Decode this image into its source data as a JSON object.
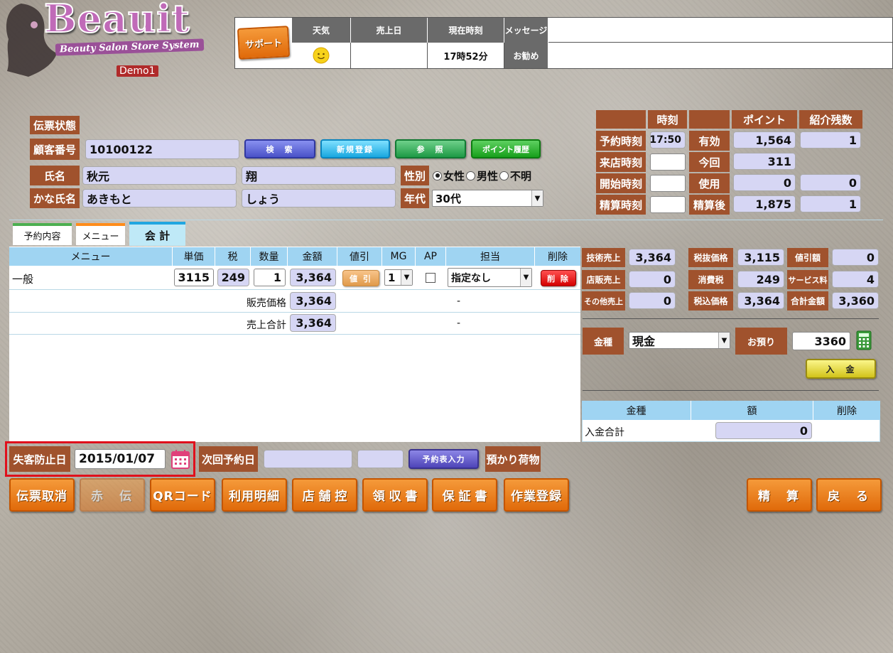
{
  "app": {
    "logo": "Beauit",
    "subtitle": "Beauty Salon Store System",
    "demo": "Demo1"
  },
  "top": {
    "support": "サポート",
    "headers": [
      "天気",
      "売上日",
      "現在時刻",
      "メッセージ"
    ],
    "weather_icon": "sun-icon",
    "sales_date": "",
    "time": "17時52分",
    "recommend": "お勧め",
    "message": ""
  },
  "customer": {
    "slip_status_label": "伝票状態",
    "number_label": "顧客番号",
    "number": "10100122",
    "search": "検　索",
    "new_register": "新規登録",
    "reference": "参　照",
    "point_history": "ポイント履歴",
    "name_label": "氏名",
    "last_name": "秋元",
    "first_name": "翔",
    "gender_label": "性別",
    "gender_options": [
      "女性",
      "男性",
      "不明"
    ],
    "gender_selected": "女性",
    "kana_label": "かな氏名",
    "kana_last": "あきもと",
    "kana_first": "しょう",
    "age_label": "年代",
    "age": "30代"
  },
  "times": {
    "time_header": "時刻",
    "point_header": "ポイント",
    "referral_header": "紹介残数",
    "rows": [
      {
        "label": "予約時刻",
        "time": "17:50",
        "plabel": "有効",
        "point": "1,564",
        "ref": "1"
      },
      {
        "label": "来店時刻",
        "time": "",
        "plabel": "今回",
        "point": "311",
        "ref": null
      },
      {
        "label": "開始時刻",
        "time": "",
        "plabel": "使用",
        "point": "0",
        "ref": "0"
      },
      {
        "label": "精算時刻",
        "time": "",
        "plabel": "精算後",
        "point": "1,875",
        "ref": "1"
      }
    ]
  },
  "tabs": [
    "予約内容",
    "メニュー",
    "会 計"
  ],
  "menu_table": {
    "headers": [
      "メニュー",
      "単価",
      "税",
      "数量",
      "金額",
      "値引",
      "MG",
      "AP",
      "担当",
      "削除"
    ],
    "row": {
      "menu": "一般",
      "price": "3115",
      "tax": "249",
      "qty": "1",
      "amount": "3,364",
      "discount": "値 引",
      "mg": "1",
      "staff": "指定なし",
      "delete": "削 除"
    },
    "sale_price_label": "販売価格",
    "sale_price": "3,364",
    "sales_total_label": "売上合計",
    "sales_total": "3,364",
    "dash": "-"
  },
  "summary": [
    {
      "l": "技術売上",
      "v": "3,364",
      "l2": "税抜価格",
      "v2": "3,115",
      "l3": "値引額",
      "v3": "0"
    },
    {
      "l": "店販売上",
      "v": "0",
      "l2": "消費税",
      "v2": "249",
      "l3": "サービス料",
      "v3": "4"
    },
    {
      "l": "その他売上",
      "v": "0",
      "l2": "税込価格",
      "v2": "3,364",
      "l3": "合計金額",
      "v3": "3,360"
    }
  ],
  "payment": {
    "type_label": "金種",
    "type": "現金",
    "deposit_label": "お預り",
    "deposit": "3360",
    "enter": "入　金"
  },
  "payment_table": {
    "headers": [
      "金種",
      "額",
      "削除"
    ],
    "total_label": "入金合計",
    "total": "0"
  },
  "bottom": {
    "churn_label": "失客防止日",
    "churn_date": "2015/01/07",
    "next_label": "次回予約日",
    "next_date": "",
    "next_time": "",
    "reserve_input": "予約表入力",
    "luggage": "預かり荷物"
  },
  "buttons": [
    "伝票取消",
    "赤　伝",
    "QRコード",
    "利用明細",
    "店 舗 控",
    "領 収 書",
    "保 証 書",
    "作業登録",
    "精　算",
    "戻　る"
  ]
}
